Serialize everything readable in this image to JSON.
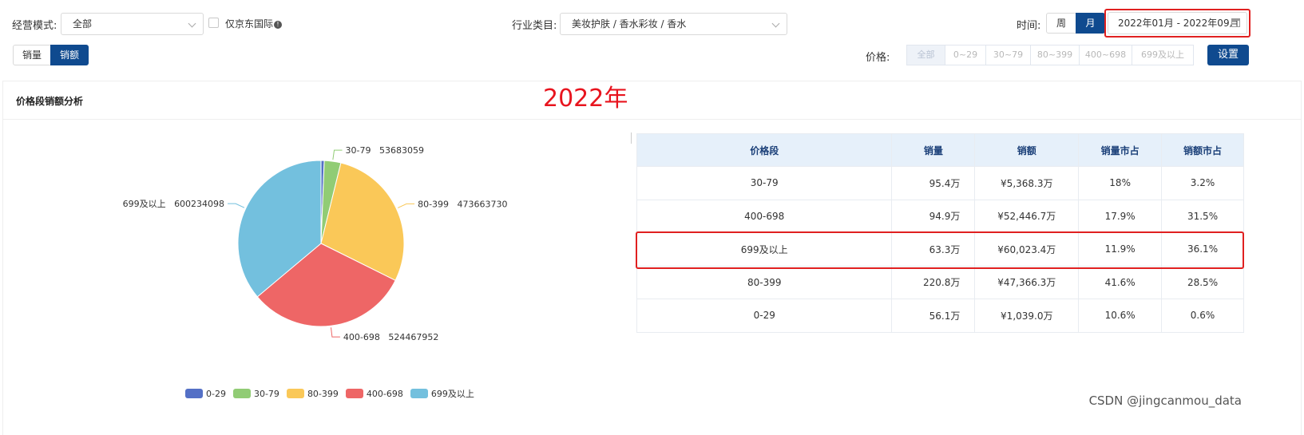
{
  "filters": {
    "mode_label": "经营模式:",
    "mode_value": "全部",
    "jd_only_label": "仅京东国际",
    "category_label": "行业类目:",
    "category_value": "美妆护肤 / 香水彩妆 / 香水",
    "time_label": "时间:",
    "time_week": "周",
    "time_month": "月",
    "date_range": "2022年01月 - 2022年09月",
    "metric_volume": "销量",
    "metric_amount": "销额",
    "price_label": "价格:",
    "price_options": [
      "全部",
      "0~29",
      "30~79",
      "80~399",
      "400~698",
      "699及以上"
    ],
    "settings_button": "设置"
  },
  "panel": {
    "title": "价格段销额分析",
    "annotation": "2022年"
  },
  "colors": {
    "primary": "#0f4a8f",
    "highlight": "#e02020",
    "slice_0_29": "#5470c6",
    "slice_30_79": "#91cc75",
    "slice_80_399": "#fac858",
    "slice_400_698": "#ee6666",
    "slice_699": "#73c0de"
  },
  "chart_data": {
    "type": "pie",
    "slices": [
      {
        "name": "0-29",
        "value": 10390000,
        "color": "#5470c6",
        "label": ""
      },
      {
        "name": "30-79",
        "value": 53683059,
        "color": "#91cc75",
        "label": "30-79   53683059"
      },
      {
        "name": "80-399",
        "value": 473663730,
        "color": "#fac858",
        "label": "80-399   473663730"
      },
      {
        "name": "400-698",
        "value": 524467952,
        "color": "#ee6666",
        "label": "400-698   524467952"
      },
      {
        "name": "699及以上",
        "value": 600234098,
        "color": "#73c0de",
        "label": "699及以上   600234098"
      }
    ],
    "legend": [
      "0-29",
      "30-79",
      "80-399",
      "400-698",
      "699及以上"
    ],
    "legend_position": "bottom"
  },
  "table": {
    "headers": [
      "价格段",
      "销量",
      "销额",
      "销量市占",
      "销额市占"
    ],
    "rows": [
      [
        "30-79",
        "95.4万",
        "¥5,368.3万",
        "18%",
        "3.2%"
      ],
      [
        "400-698",
        "94.9万",
        "¥52,446.7万",
        "17.9%",
        "31.5%"
      ],
      [
        "699及以上",
        "63.3万",
        "¥60,023.4万",
        "11.9%",
        "36.1%"
      ],
      [
        "80-399",
        "220.8万",
        "¥47,366.3万",
        "41.6%",
        "28.5%"
      ],
      [
        "0-29",
        "56.1万",
        "¥1,039.0万",
        "10.6%",
        "0.6%"
      ]
    ]
  },
  "watermark": "CSDN @jingcanmou_data"
}
